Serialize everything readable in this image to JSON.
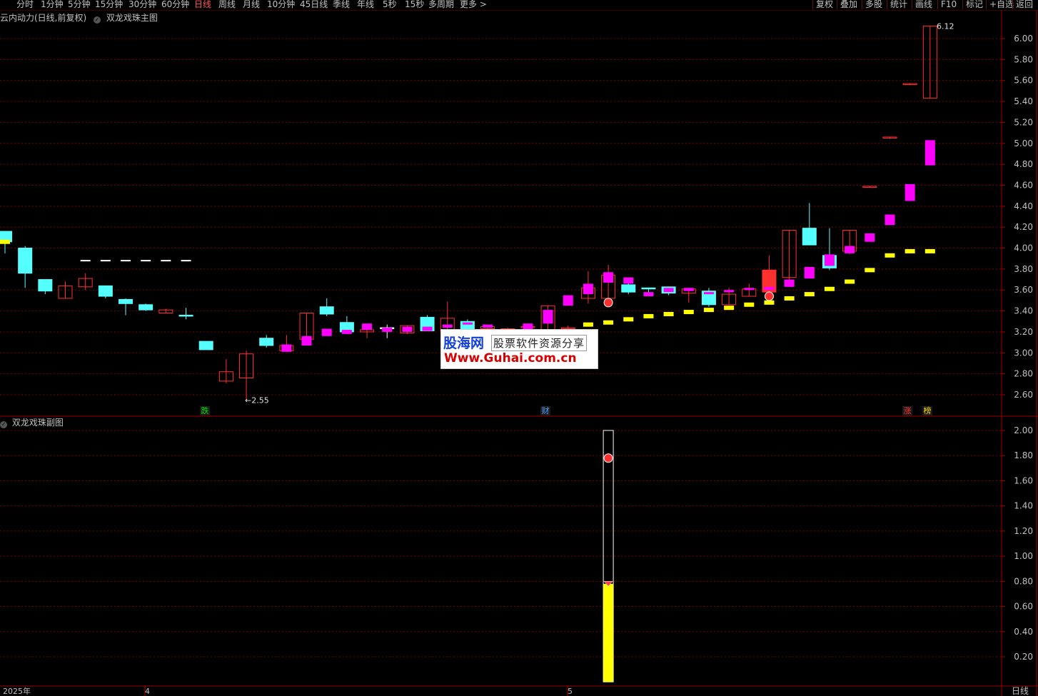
{
  "toolbar": {
    "periods": [
      "分时",
      "1分钟",
      "5分钟",
      "15分钟",
      "30分钟",
      "60分钟",
      "日线",
      "周线",
      "月线",
      "10分钟",
      "45日线",
      "季线",
      "年线",
      "5秒",
      "15秒",
      "多周期",
      "更多 >"
    ],
    "active_period": "日线",
    "tools": [
      "复权",
      "叠加",
      "多股",
      "统计",
      "画线",
      "F10",
      "标记",
      "+自选",
      "返回"
    ]
  },
  "main_panel": {
    "title": "云内动力(日线,前复权)",
    "indicator": "双龙戏珠主图",
    "low_label": "←2.55",
    "high_label": "6.12",
    "signals": [
      {
        "text": "跌",
        "color": "#00dd00"
      },
      {
        "text": "财",
        "color": "#4aa0ff"
      },
      {
        "text": "涨",
        "color": "#ff3030"
      },
      {
        "text": "榜",
        "color": "#ffd700"
      }
    ]
  },
  "sub_panel": {
    "title": "双龙戏珠副图"
  },
  "x_axis": {
    "labels": [
      "2025年",
      "4",
      "5"
    ],
    "period_label": "日线"
  },
  "watermark": {
    "brand": "股海网",
    "slogan": "股票软件资源分享",
    "url": "Www.Guhai.com.cn"
  },
  "colors": {
    "up": "#ff3030",
    "down_cyan": "#54ffff",
    "magenta": "#ff00ff",
    "yellow": "#ffff00",
    "green": "#00dd00",
    "grid": "#7a0000",
    "axis_text": "#c0c0c0"
  },
  "chart_data": [
    {
      "type": "candlestick",
      "title": "双龙戏珠主图",
      "ylim": [
        2.5,
        6.25
      ],
      "y_ticks": [
        2.6,
        2.8,
        3.0,
        3.2,
        3.4,
        3.6,
        3.8,
        4.0,
        4.2,
        4.4,
        4.6,
        4.8,
        5.0,
        5.2,
        5.4,
        5.6,
        5.8,
        6.0
      ],
      "candles": [
        {
          "o": 4.16,
          "c": 4.06,
          "h": 4.16,
          "l": 3.95
        },
        {
          "o": 4.0,
          "c": 3.76,
          "h": 4.02,
          "l": 3.62
        },
        {
          "o": 3.7,
          "c": 3.59,
          "h": 3.7,
          "l": 3.56
        },
        {
          "o": 3.52,
          "c": 3.64,
          "h": 3.68,
          "l": 3.52
        },
        {
          "o": 3.63,
          "c": 3.71,
          "h": 3.76,
          "l": 3.6
        },
        {
          "o": 3.64,
          "c": 3.54,
          "h": 3.64,
          "l": 3.52
        },
        {
          "o": 3.51,
          "c": 3.47,
          "h": 3.52,
          "l": 3.36
        },
        {
          "o": 3.46,
          "c": 3.41,
          "h": 3.47,
          "l": 3.4
        },
        {
          "o": 3.38,
          "c": 3.41,
          "h": 3.42,
          "l": 3.38
        },
        {
          "o": 3.36,
          "c": 3.35,
          "h": 3.43,
          "l": 3.32
        },
        {
          "o": 3.11,
          "c": 3.03,
          "h": 3.11,
          "l": 3.03
        },
        {
          "o": 2.73,
          "c": 2.82,
          "h": 2.94,
          "l": 2.71
        },
        {
          "o": 2.76,
          "c": 2.99,
          "h": 3.02,
          "l": 2.55
        },
        {
          "o": 3.14,
          "c": 3.07,
          "h": 3.17,
          "l": 3.05
        },
        {
          "o": 3.02,
          "c": 3.07,
          "h": 3.17,
          "l": 3.01
        },
        {
          "o": 3.13,
          "c": 3.38,
          "h": 3.38,
          "l": 3.13
        },
        {
          "o": 3.44,
          "c": 3.37,
          "h": 3.52,
          "l": 3.35
        },
        {
          "o": 3.29,
          "c": 3.2,
          "h": 3.35,
          "l": 3.18
        },
        {
          "o": 3.2,
          "c": 3.22,
          "h": 3.25,
          "l": 3.14
        },
        {
          "o": 3.24,
          "c": 3.24,
          "h": 3.27,
          "l": 3.14
        },
        {
          "o": 3.19,
          "c": 3.26,
          "h": 3.26,
          "l": 3.18
        },
        {
          "o": 3.34,
          "c": 3.21,
          "h": 3.36,
          "l": 3.21
        },
        {
          "o": 3.21,
          "c": 3.33,
          "h": 3.49,
          "l": 3.2
        },
        {
          "o": 3.3,
          "c": 3.22,
          "h": 3.32,
          "l": 3.2
        },
        {
          "o": 3.23,
          "c": 3.25,
          "h": 3.26,
          "l": 3.2
        },
        {
          "o": 3.21,
          "c": 3.23,
          "h": 3.24,
          "l": 3.18
        },
        {
          "o": 3.24,
          "c": 3.25,
          "h": 3.26,
          "l": 3.21
        },
        {
          "o": 3.2,
          "c": 3.45,
          "h": 3.45,
          "l": 3.2
        },
        {
          "o": 3.23,
          "c": 3.24,
          "h": 3.26,
          "l": 3.22
        },
        {
          "o": 3.52,
          "c": 3.62,
          "h": 3.78,
          "l": 3.47
        },
        {
          "o": 3.52,
          "c": 3.74,
          "h": 3.84,
          "l": 3.52
        },
        {
          "o": 3.65,
          "c": 3.58,
          "h": 3.69,
          "l": 3.56
        },
        {
          "o": 3.62,
          "c": 3.61,
          "h": 3.62,
          "l": 3.55
        },
        {
          "o": 3.63,
          "c": 3.57,
          "h": 3.63,
          "l": 3.55
        },
        {
          "o": 3.57,
          "c": 3.61,
          "h": 3.62,
          "l": 3.48
        },
        {
          "o": 3.59,
          "c": 3.46,
          "h": 3.62,
          "l": 3.44
        },
        {
          "o": 3.46,
          "c": 3.56,
          "h": 3.62,
          "l": 3.46
        },
        {
          "o": 3.54,
          "c": 3.61,
          "h": 3.66,
          "l": 3.54
        },
        {
          "o": 3.58,
          "c": 3.79,
          "h": 3.93,
          "l": 3.57
        },
        {
          "o": 3.72,
          "c": 4.17,
          "h": 4.17,
          "l": 3.68
        },
        {
          "o": 4.19,
          "c": 4.03,
          "h": 4.43,
          "l": 4.03
        },
        {
          "o": 3.93,
          "c": 3.81,
          "h": 4.19,
          "l": 3.79
        },
        {
          "o": 3.97,
          "c": 4.17,
          "h": 4.17,
          "l": 3.94
        },
        {
          "o": 4.58,
          "c": 4.59,
          "h": 4.59,
          "l": 4.58
        },
        {
          "o": 5.05,
          "c": 5.06,
          "h": 5.06,
          "l": 5.05
        },
        {
          "o": 5.56,
          "c": 5.57,
          "h": 5.57,
          "l": 5.56
        },
        {
          "o": 5.43,
          "c": 6.12,
          "h": 6.12,
          "l": 5.43
        }
      ],
      "ma_band": [
        [
          null,
          null
        ],
        [
          null,
          null
        ],
        [
          null,
          null
        ],
        [
          null,
          null
        ],
        [
          null,
          null
        ],
        [
          null,
          null
        ],
        [
          null,
          null
        ],
        [
          null,
          null
        ],
        [
          null,
          null
        ],
        [
          null,
          null
        ],
        [
          null,
          null
        ],
        [
          null,
          null
        ],
        [
          null,
          null
        ],
        [
          null,
          null
        ],
        [
          3.01,
          3.08
        ],
        [
          3.07,
          3.16
        ],
        [
          3.16,
          3.23
        ],
        [
          3.18,
          3.22
        ],
        [
          3.22,
          3.28
        ],
        [
          3.2,
          3.24
        ],
        [
          3.2,
          3.25
        ],
        [
          3.21,
          3.25
        ],
        [
          3.24,
          3.27
        ],
        [
          3.27,
          3.29
        ],
        [
          3.24,
          3.27
        ],
        [
          3.2,
          3.22
        ],
        [
          3.2,
          3.28
        ],
        [
          3.28,
          3.41
        ],
        [
          3.45,
          3.55
        ],
        [
          3.56,
          3.66
        ],
        [
          3.67,
          3.77
        ],
        [
          3.66,
          3.72
        ],
        [
          3.54,
          3.58
        ],
        [
          3.58,
          3.62
        ],
        [
          3.59,
          3.62
        ],
        [
          3.56,
          3.58
        ],
        [
          3.59,
          3.6
        ],
        [
          3.61,
          3.62
        ],
        [
          3.6,
          3.63
        ],
        [
          3.63,
          3.7
        ],
        [
          3.71,
          3.82
        ],
        [
          3.83,
          3.94
        ],
        [
          3.95,
          4.02
        ],
        [
          4.06,
          4.14
        ],
        [
          4.22,
          4.32
        ],
        [
          4.45,
          4.61
        ],
        [
          4.79,
          5.03
        ]
      ],
      "yellow_line": [
        4.06,
        null,
        null,
        null,
        null,
        null,
        null,
        null,
        null,
        null,
        null,
        null,
        null,
        null,
        null,
        null,
        null,
        null,
        null,
        null,
        null,
        null,
        null,
        null,
        null,
        null,
        null,
        null,
        3.19,
        3.27,
        3.29,
        3.32,
        3.35,
        3.37,
        3.39,
        3.41,
        3.43,
        3.46,
        3.48,
        3.52,
        3.56,
        3.61,
        3.68,
        3.79,
        3.93,
        3.97,
        3.97
      ]
    },
    {
      "type": "bar",
      "title": "双龙戏珠副图",
      "ylim": [
        0,
        2.1
      ],
      "y_ticks": [
        0.2,
        0.4,
        0.6,
        0.8,
        1.0,
        1.2,
        1.4,
        1.6,
        1.8,
        2.0
      ],
      "bar_index": 30,
      "frame_top": 2.0,
      "fill_top": 0.78
    }
  ]
}
